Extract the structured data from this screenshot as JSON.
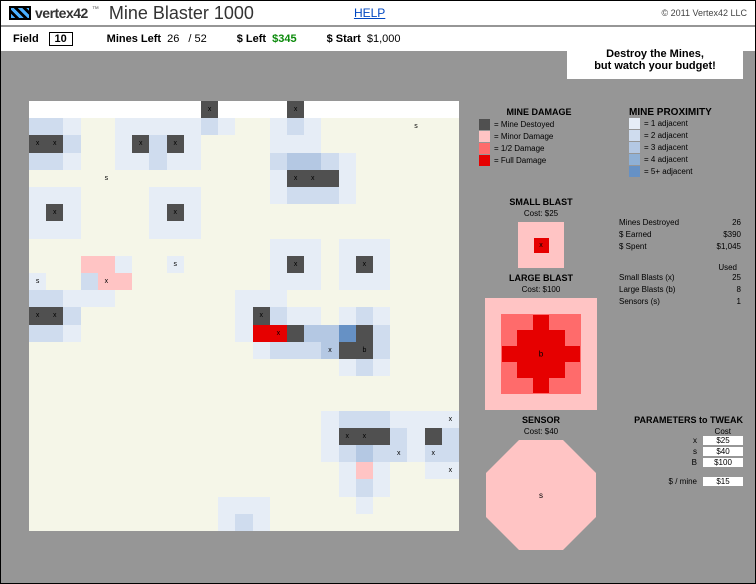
{
  "header": {
    "logo_text": "vertex",
    "logo_num": "42",
    "title": "Mine Blaster 1000",
    "help": "HELP",
    "copyright": "© 2011 Vertex42 LLC"
  },
  "stats": {
    "field_label": "Field",
    "field_value": "10",
    "mines_left_label": "Mines Left",
    "mines_left": "26",
    "mines_total": "52",
    "dollar_left_label": "$ Left",
    "dollar_left": "$345",
    "dollar_start_label": "$ Start",
    "dollar_start": "$1,000"
  },
  "tagline": {
    "line1": "Destroy the Mines,",
    "line2": "but watch your budget!"
  },
  "legend_damage": {
    "title": "MINE DAMAGE",
    "items": [
      {
        "label": "=  Mine Destoyed",
        "color": "#505050"
      },
      {
        "label": "=  Minor Damage",
        "color": "#ffc4c4"
      },
      {
        "label": "=  1/2 Damage",
        "color": "#ff6b6b"
      },
      {
        "label": "=  Full Damage",
        "color": "#e60000"
      }
    ]
  },
  "legend_prox": {
    "title": "MINE PROXIMITY",
    "items": [
      {
        "label": "= 1 adjacent",
        "color": "#e6edf6"
      },
      {
        "label": "= 2 adjacent",
        "color": "#cfdcee"
      },
      {
        "label": "= 3 adjacent",
        "color": "#b4c8e3"
      },
      {
        "label": "= 4 adjacent",
        "color": "#8fb0d5"
      },
      {
        "label": "= 5+ adjacent",
        "color": "#6691c5"
      }
    ]
  },
  "small_blast": {
    "title": "SMALL BLAST",
    "cost": "Cost: $25",
    "glyph": "x"
  },
  "large_blast": {
    "title": "LARGE BLAST",
    "cost": "Cost: $100",
    "glyph": "b"
  },
  "sensor": {
    "title": "SENSOR",
    "cost": "Cost: $40",
    "glyph": "s"
  },
  "right_stats": {
    "mines_destroyed_label": "Mines Destroyed",
    "mines_destroyed": "26",
    "earned_label": "$ Earned",
    "earned": "$390",
    "spent_label": "$ Spent",
    "spent": "$1,045",
    "used_label": "Used",
    "small_label": "Small Blasts (x)",
    "small_used": "25",
    "large_label": "Large Blasts (b)",
    "large_used": "8",
    "sensor_label": "Sensors (s)",
    "sensor_used": "1"
  },
  "params": {
    "title": "PARAMETERS to TWEAK",
    "cost_label": "Cost",
    "x_label": "x",
    "x_val": "$25",
    "s_label": "s",
    "s_val": "$40",
    "b_label": "B",
    "b_val": "$100",
    "permine_label": "$ / mine",
    "permine_val": "$15"
  },
  "grid_overlays": [
    {
      "r": 0,
      "c": 0,
      "rspan": 1,
      "cspan": 25,
      "cls": "whiterow"
    },
    {
      "r": 0,
      "c": 10,
      "cls": "mine mx"
    },
    {
      "r": 0,
      "c": 15,
      "cls": "mine mx"
    },
    {
      "r": 1,
      "c": 0,
      "cls": "p2"
    },
    {
      "r": 1,
      "c": 1,
      "cls": "p2"
    },
    {
      "r": 1,
      "c": 2,
      "cls": "p1"
    },
    {
      "r": 1,
      "c": 5,
      "cls": "p1"
    },
    {
      "r": 1,
      "c": 6,
      "cls": "p1"
    },
    {
      "r": 1,
      "c": 7,
      "cls": "p1"
    },
    {
      "r": 1,
      "c": 8,
      "cls": "p1"
    },
    {
      "r": 1,
      "c": 9,
      "cls": "p1"
    },
    {
      "r": 1,
      "c": 10,
      "cls": "p2"
    },
    {
      "r": 1,
      "c": 11,
      "cls": "p1"
    },
    {
      "r": 1,
      "c": 14,
      "cls": "p1"
    },
    {
      "r": 1,
      "c": 15,
      "cls": "p2"
    },
    {
      "r": 1,
      "c": 16,
      "cls": "p1"
    },
    {
      "r": 1,
      "c": 22,
      "cls": "ms"
    },
    {
      "r": 2,
      "c": 0,
      "cls": "mine mx"
    },
    {
      "r": 2,
      "c": 1,
      "cls": "mine mx"
    },
    {
      "r": 2,
      "c": 2,
      "cls": "p2"
    },
    {
      "r": 2,
      "c": 5,
      "cls": "p1"
    },
    {
      "r": 2,
      "c": 6,
      "cls": "mine mx"
    },
    {
      "r": 2,
      "c": 7,
      "cls": "p2"
    },
    {
      "r": 2,
      "c": 8,
      "cls": "mine mx"
    },
    {
      "r": 2,
      "c": 9,
      "cls": "p1"
    },
    {
      "r": 2,
      "c": 14,
      "cls": "p1"
    },
    {
      "r": 2,
      "c": 15,
      "cls": "p1"
    },
    {
      "r": 2,
      "c": 16,
      "cls": "p1"
    },
    {
      "r": 3,
      "c": 0,
      "cls": "p2"
    },
    {
      "r": 3,
      "c": 1,
      "cls": "p2"
    },
    {
      "r": 3,
      "c": 2,
      "cls": "p1"
    },
    {
      "r": 3,
      "c": 5,
      "cls": "p1"
    },
    {
      "r": 3,
      "c": 6,
      "cls": "p1"
    },
    {
      "r": 3,
      "c": 7,
      "cls": "p2"
    },
    {
      "r": 3,
      "c": 8,
      "cls": "p1"
    },
    {
      "r": 3,
      "c": 9,
      "cls": "p1"
    },
    {
      "r": 3,
      "c": 14,
      "cls": "p2"
    },
    {
      "r": 3,
      "c": 15,
      "cls": "p3"
    },
    {
      "r": 3,
      "c": 16,
      "cls": "p3"
    },
    {
      "r": 3,
      "c": 17,
      "cls": "p2"
    },
    {
      "r": 3,
      "c": 18,
      "cls": "p1"
    },
    {
      "r": 4,
      "c": 4,
      "cls": "ms"
    },
    {
      "r": 4,
      "c": 14,
      "cls": "p1"
    },
    {
      "r": 4,
      "c": 15,
      "cls": "mine mx"
    },
    {
      "r": 4,
      "c": 16,
      "cls": "mine mx"
    },
    {
      "r": 4,
      "c": 17,
      "cls": "mine"
    },
    {
      "r": 4,
      "c": 18,
      "cls": "p1"
    },
    {
      "r": 5,
      "c": 0,
      "cls": "p1"
    },
    {
      "r": 5,
      "c": 1,
      "cls": "p1"
    },
    {
      "r": 5,
      "c": 2,
      "cls": "p1"
    },
    {
      "r": 5,
      "c": 7,
      "cls": "p1"
    },
    {
      "r": 5,
      "c": 8,
      "cls": "p1"
    },
    {
      "r": 5,
      "c": 9,
      "cls": "p1"
    },
    {
      "r": 5,
      "c": 14,
      "cls": "p1"
    },
    {
      "r": 5,
      "c": 15,
      "cls": "p2"
    },
    {
      "r": 5,
      "c": 16,
      "cls": "p2"
    },
    {
      "r": 5,
      "c": 17,
      "cls": "p2"
    },
    {
      "r": 5,
      "c": 18,
      "cls": "p1"
    },
    {
      "r": 6,
      "c": 0,
      "cls": "p1"
    },
    {
      "r": 6,
      "c": 1,
      "cls": "mine mx"
    },
    {
      "r": 6,
      "c": 2,
      "cls": "p1"
    },
    {
      "r": 6,
      "c": 7,
      "cls": "p1"
    },
    {
      "r": 6,
      "c": 8,
      "cls": "mine mx"
    },
    {
      "r": 6,
      "c": 9,
      "cls": "p1"
    },
    {
      "r": 7,
      "c": 0,
      "cls": "p1"
    },
    {
      "r": 7,
      "c": 1,
      "cls": "p1"
    },
    {
      "r": 7,
      "c": 2,
      "cls": "p1"
    },
    {
      "r": 7,
      "c": 7,
      "cls": "p1"
    },
    {
      "r": 7,
      "c": 8,
      "cls": "p1"
    },
    {
      "r": 7,
      "c": 9,
      "cls": "p1"
    },
    {
      "r": 8,
      "c": 14,
      "cls": "p1"
    },
    {
      "r": 8,
      "c": 15,
      "cls": "p1"
    },
    {
      "r": 8,
      "c": 16,
      "cls": "p1"
    },
    {
      "r": 8,
      "c": 18,
      "cls": "p1"
    },
    {
      "r": 8,
      "c": 19,
      "cls": "p1"
    },
    {
      "r": 8,
      "c": 20,
      "cls": "p1"
    },
    {
      "r": 9,
      "c": 3,
      "cls": "minor"
    },
    {
      "r": 9,
      "c": 4,
      "cls": "minor"
    },
    {
      "r": 9,
      "c": 5,
      "cls": "p1"
    },
    {
      "r": 9,
      "c": 8,
      "cls": "p1 ms"
    },
    {
      "r": 9,
      "c": 14,
      "cls": "p1"
    },
    {
      "r": 9,
      "c": 15,
      "cls": "mine mx"
    },
    {
      "r": 9,
      "c": 16,
      "cls": "p1"
    },
    {
      "r": 9,
      "c": 18,
      "cls": "p1"
    },
    {
      "r": 9,
      "c": 19,
      "cls": "mine mx"
    },
    {
      "r": 9,
      "c": 20,
      "cls": "p1"
    },
    {
      "r": 10,
      "c": 0,
      "cls": "p1 ms"
    },
    {
      "r": 10,
      "c": 3,
      "cls": "p2"
    },
    {
      "r": 10,
      "c": 4,
      "cls": "minor mx"
    },
    {
      "r": 10,
      "c": 5,
      "cls": "minor"
    },
    {
      "r": 10,
      "c": 14,
      "cls": "p1"
    },
    {
      "r": 10,
      "c": 15,
      "cls": "p1"
    },
    {
      "r": 10,
      "c": 16,
      "cls": "p1"
    },
    {
      "r": 10,
      "c": 18,
      "cls": "p1"
    },
    {
      "r": 10,
      "c": 19,
      "cls": "p1"
    },
    {
      "r": 10,
      "c": 20,
      "cls": "p1"
    },
    {
      "r": 11,
      "c": 0,
      "cls": "p2"
    },
    {
      "r": 11,
      "c": 1,
      "cls": "p2"
    },
    {
      "r": 11,
      "c": 2,
      "cls": "p1"
    },
    {
      "r": 11,
      "c": 3,
      "cls": "p1"
    },
    {
      "r": 11,
      "c": 4,
      "cls": "p1"
    },
    {
      "r": 11,
      "c": 12,
      "cls": "p1"
    },
    {
      "r": 11,
      "c": 13,
      "cls": "p1"
    },
    {
      "r": 11,
      "c": 14,
      "cls": "p1"
    },
    {
      "r": 12,
      "c": 0,
      "cls": "mine mx"
    },
    {
      "r": 12,
      "c": 1,
      "cls": "mine mx"
    },
    {
      "r": 12,
      "c": 2,
      "cls": "p2"
    },
    {
      "r": 12,
      "c": 12,
      "cls": "p1"
    },
    {
      "r": 12,
      "c": 13,
      "cls": "mine mx"
    },
    {
      "r": 12,
      "c": 14,
      "cls": "p2"
    },
    {
      "r": 12,
      "c": 15,
      "cls": "p1"
    },
    {
      "r": 12,
      "c": 16,
      "cls": "p1"
    },
    {
      "r": 12,
      "c": 18,
      "cls": "p1"
    },
    {
      "r": 12,
      "c": 19,
      "cls": "p2"
    },
    {
      "r": 12,
      "c": 20,
      "cls": "p1"
    },
    {
      "r": 13,
      "c": 0,
      "cls": "p2"
    },
    {
      "r": 13,
      "c": 1,
      "cls": "p2"
    },
    {
      "r": 13,
      "c": 2,
      "cls": "p1"
    },
    {
      "r": 13,
      "c": 12,
      "cls": "p1"
    },
    {
      "r": 13,
      "c": 13,
      "cls": "full"
    },
    {
      "r": 13,
      "c": 14,
      "cls": "full mx"
    },
    {
      "r": 13,
      "c": 15,
      "cls": "mine"
    },
    {
      "r": 13,
      "c": 16,
      "cls": "p3"
    },
    {
      "r": 13,
      "c": 17,
      "cls": "p3"
    },
    {
      "r": 13,
      "c": 18,
      "cls": "p5"
    },
    {
      "r": 13,
      "c": 19,
      "cls": "mine"
    },
    {
      "r": 13,
      "c": 20,
      "cls": "p2"
    },
    {
      "r": 14,
      "c": 13,
      "cls": "p1"
    },
    {
      "r": 14,
      "c": 14,
      "cls": "p2"
    },
    {
      "r": 14,
      "c": 15,
      "cls": "p2"
    },
    {
      "r": 14,
      "c": 16,
      "cls": "p2"
    },
    {
      "r": 14,
      "c": 17,
      "cls": "p3 mx"
    },
    {
      "r": 14,
      "c": 18,
      "cls": "mine"
    },
    {
      "r": 14,
      "c": 19,
      "cls": "mine mb"
    },
    {
      "r": 14,
      "c": 20,
      "cls": "p2"
    },
    {
      "r": 15,
      "c": 18,
      "cls": "p1"
    },
    {
      "r": 15,
      "c": 19,
      "cls": "p2"
    },
    {
      "r": 15,
      "c": 20,
      "cls": "p1"
    },
    {
      "r": 18,
      "c": 17,
      "cls": "p1"
    },
    {
      "r": 18,
      "c": 18,
      "cls": "p2"
    },
    {
      "r": 18,
      "c": 19,
      "cls": "p2"
    },
    {
      "r": 18,
      "c": 20,
      "cls": "p2"
    },
    {
      "r": 18,
      "c": 21,
      "cls": "p1"
    },
    {
      "r": 18,
      "c": 22,
      "cls": "p1"
    },
    {
      "r": 18,
      "c": 23,
      "cls": "p1"
    },
    {
      "r": 18,
      "c": 24,
      "cls": "p1 mx"
    },
    {
      "r": 19,
      "c": 17,
      "cls": "p1"
    },
    {
      "r": 19,
      "c": 18,
      "cls": "mine mx"
    },
    {
      "r": 19,
      "c": 19,
      "cls": "mine mx"
    },
    {
      "r": 19,
      "c": 20,
      "cls": "mine"
    },
    {
      "r": 19,
      "c": 21,
      "cls": "p2"
    },
    {
      "r": 19,
      "c": 22,
      "cls": "p1"
    },
    {
      "r": 19,
      "c": 23,
      "cls": "mine"
    },
    {
      "r": 19,
      "c": 24,
      "cls": "p2"
    },
    {
      "r": 20,
      "c": 17,
      "cls": "p1"
    },
    {
      "r": 20,
      "c": 18,
      "cls": "p2"
    },
    {
      "r": 20,
      "c": 19,
      "cls": "p3"
    },
    {
      "r": 20,
      "c": 20,
      "cls": "p2"
    },
    {
      "r": 20,
      "c": 21,
      "cls": "p2 mx"
    },
    {
      "r": 20,
      "c": 22,
      "cls": "p1"
    },
    {
      "r": 20,
      "c": 23,
      "cls": "p2 mx"
    },
    {
      "r": 20,
      "c": 24,
      "cls": "p2"
    },
    {
      "r": 21,
      "c": 18,
      "cls": "p1"
    },
    {
      "r": 21,
      "c": 19,
      "cls": "minor"
    },
    {
      "r": 21,
      "c": 20,
      "cls": "p1"
    },
    {
      "r": 21,
      "c": 23,
      "cls": "p1"
    },
    {
      "r": 21,
      "c": 24,
      "cls": "p1 mx"
    },
    {
      "r": 22,
      "c": 18,
      "cls": "p1"
    },
    {
      "r": 22,
      "c": 19,
      "cls": "p2"
    },
    {
      "r": 22,
      "c": 20,
      "cls": "p1"
    },
    {
      "r": 23,
      "c": 19,
      "cls": "p1"
    },
    {
      "r": 23,
      "c": 11,
      "cls": "p1"
    },
    {
      "r": 23,
      "c": 12,
      "cls": "p1"
    },
    {
      "r": 23,
      "c": 13,
      "cls": "p1"
    },
    {
      "r": 24,
      "c": 11,
      "cls": "p1"
    },
    {
      "r": 24,
      "c": 12,
      "cls": "p2"
    },
    {
      "r": 24,
      "c": 13,
      "cls": "p1"
    }
  ]
}
